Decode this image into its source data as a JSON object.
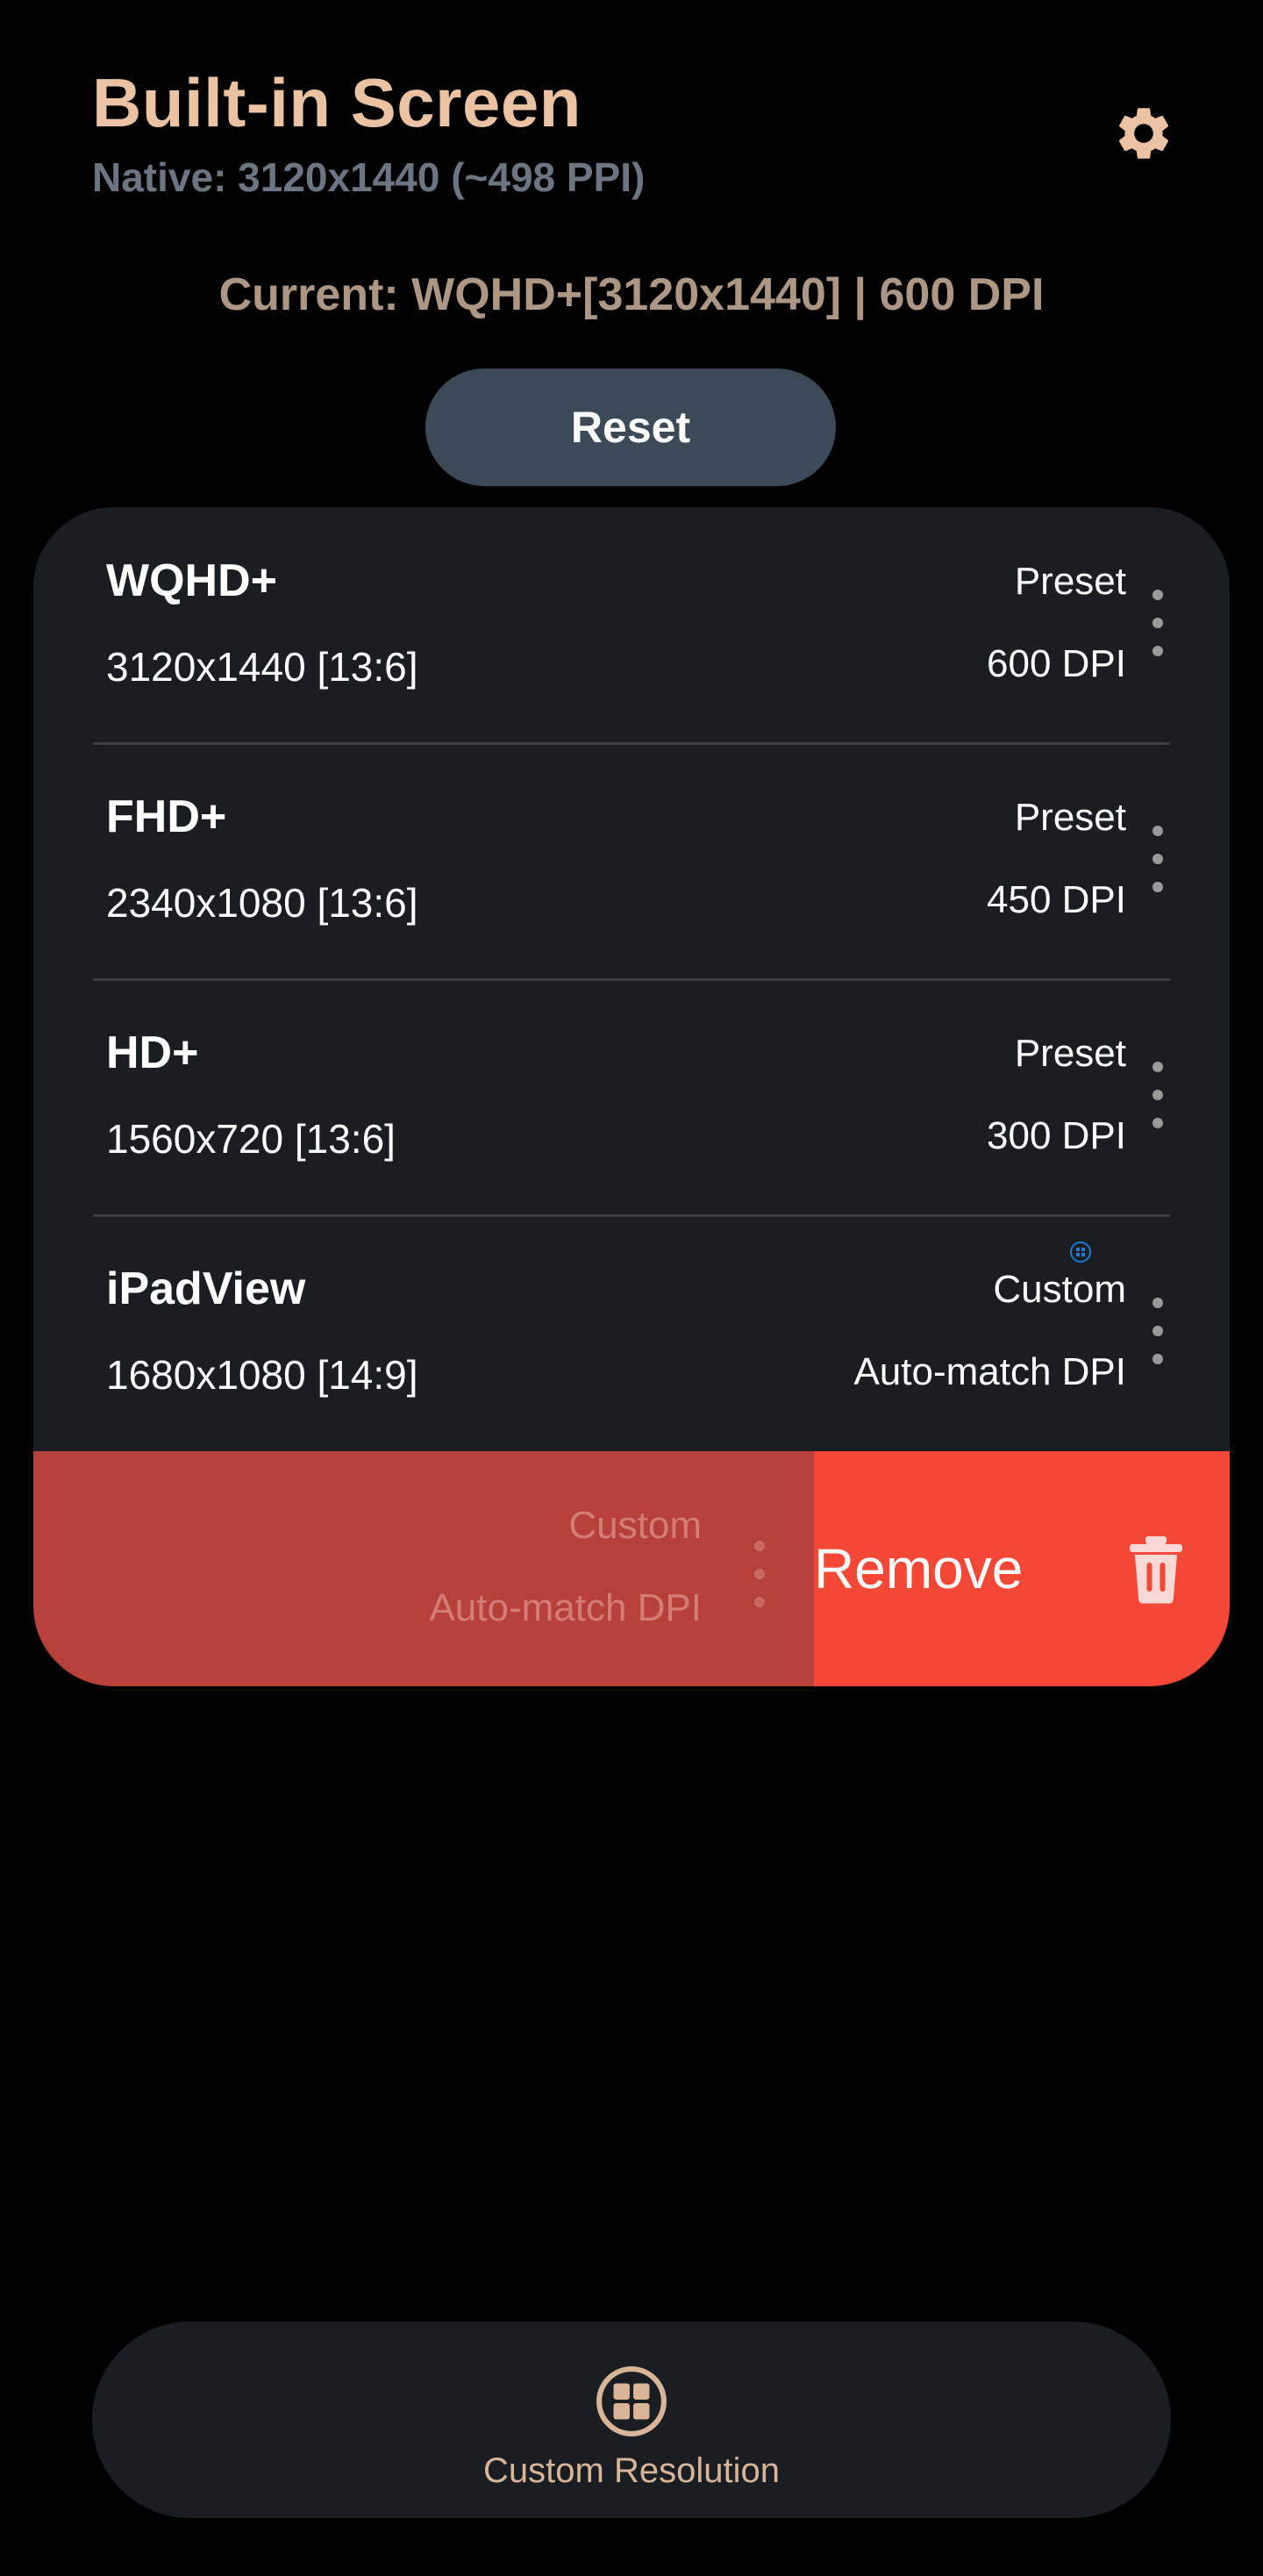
{
  "header": {
    "title": "Built-in Screen",
    "subtitle": "Native: 3120x1440 (~498 PPI)",
    "settings_icon": "gear-icon"
  },
  "current": "Current: WQHD+[3120x1440] | 600 DPI",
  "reset_label": "Reset",
  "resolutions": [
    {
      "name": "WQHD+",
      "resolution": "3120x1440 [13:6]",
      "type": "Preset",
      "dpi": "600 DPI"
    },
    {
      "name": "FHD+",
      "resolution": "2340x1080 [13:6]",
      "type": "Preset",
      "dpi": "450 DPI"
    },
    {
      "name": "HD+",
      "resolution": "1560x720 [13:6]",
      "type": "Preset",
      "dpi": "300 DPI"
    },
    {
      "name": "iPadView",
      "resolution": "1680x1080 [14:9]",
      "type": "Custom",
      "dpi": "Auto-match DPI"
    }
  ],
  "swiped_item": {
    "type": "Custom",
    "dpi": "Auto-match DPI",
    "action_label": "Remove",
    "action_icon": "trash-icon"
  },
  "bottom_bar": {
    "label": "Custom Resolution",
    "icon": "grid-icon"
  },
  "colors": {
    "title": "#EBC3A2",
    "subtitle": "#6C7682",
    "current": "#AD9683",
    "reset_bg": "#3C4A58",
    "card_bg": "#1A1D22",
    "remove_bg": "#F24835",
    "swipe_bg": "#B7403A",
    "accent": "#D8B598"
  }
}
